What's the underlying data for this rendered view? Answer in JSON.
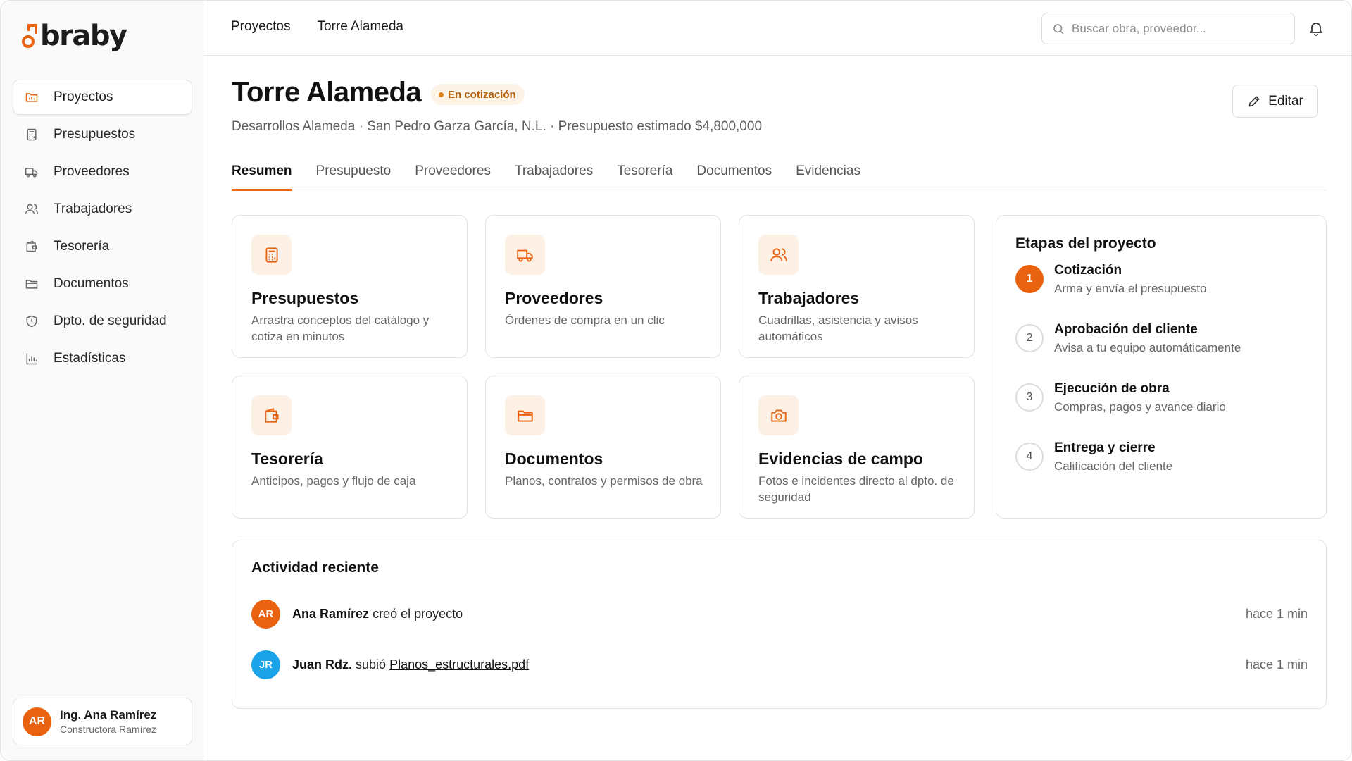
{
  "brand": {
    "name": "braby",
    "accent": "#e8620f"
  },
  "sidebar": {
    "items": [
      {
        "label": "Proyectos",
        "icon": "projects-icon",
        "active": true
      },
      {
        "label": "Presupuestos",
        "icon": "calculator-icon",
        "active": false
      },
      {
        "label": "Proveedores",
        "icon": "truck-icon",
        "active": false
      },
      {
        "label": "Trabajadores",
        "icon": "users-icon",
        "active": false
      },
      {
        "label": "Tesorería",
        "icon": "wallet-icon",
        "active": false
      },
      {
        "label": "Documentos",
        "icon": "folder-icon",
        "active": false
      },
      {
        "label": "Dpto. de seguridad",
        "icon": "shield-icon",
        "active": false
      },
      {
        "label": "Estadísticas",
        "icon": "chart-icon",
        "active": false
      }
    ],
    "user": {
      "initials": "AR",
      "name": "Ing. Ana Ramírez",
      "company": "Constructora Ramírez"
    }
  },
  "topbar": {
    "breadcrumb": [
      "Proyectos",
      "Torre Alameda"
    ],
    "search_placeholder": "Buscar obra, proveedor..."
  },
  "project": {
    "title": "Torre Alameda",
    "status": "En cotización",
    "subtitle": "Desarrollos Alameda · San Pedro Garza García, N.L. · Presupuesto estimado $4,800,000",
    "edit_label": "Editar"
  },
  "tabs": [
    "Resumen",
    "Presupuesto",
    "Proveedores",
    "Trabajadores",
    "Tesorería",
    "Documentos",
    "Evidencias"
  ],
  "cards": [
    {
      "title": "Presupuestos",
      "desc": "Arrastra conceptos del catálogo y cotiza en minutos",
      "icon": "calculator-icon"
    },
    {
      "title": "Proveedores",
      "desc": "Órdenes de compra en un clic",
      "icon": "truck-icon"
    },
    {
      "title": "Trabajadores",
      "desc": "Cuadrillas, asistencia y avisos automáticos",
      "icon": "users-icon"
    },
    {
      "title": "Tesorería",
      "desc": "Anticipos, pagos y flujo de caja",
      "icon": "wallet-icon"
    },
    {
      "title": "Documentos",
      "desc": "Planos, contratos y permisos de obra",
      "icon": "folder-icon"
    },
    {
      "title": "Evidencias de campo",
      "desc": "Fotos e incidentes directo al dpto. de seguridad",
      "icon": "camera-icon"
    }
  ],
  "stages": {
    "title": "Etapas del proyecto",
    "items": [
      {
        "num": "1",
        "title": "Cotización",
        "desc": "Arma y envía el presupuesto",
        "active": true
      },
      {
        "num": "2",
        "title": "Aprobación del cliente",
        "desc": "Avisa a tu equipo automáticamente",
        "active": false
      },
      {
        "num": "3",
        "title": "Ejecución de obra",
        "desc": "Compras, pagos y avance diario",
        "active": false
      },
      {
        "num": "4",
        "title": "Entrega y cierre",
        "desc": "Calificación del cliente",
        "active": false
      }
    ]
  },
  "activity": {
    "title": "Actividad reciente",
    "items": [
      {
        "initials": "AR",
        "color": "#e8620f",
        "name": "Ana Ramírez",
        "action": "creó el proyecto",
        "link": "",
        "time": "hace 1 min"
      },
      {
        "initials": "JR",
        "color": "#1aa3e8",
        "name": "Juan Rdz.",
        "action": "subió",
        "link": "Planos_estructurales.pdf",
        "time": "hace 1 min"
      }
    ]
  }
}
